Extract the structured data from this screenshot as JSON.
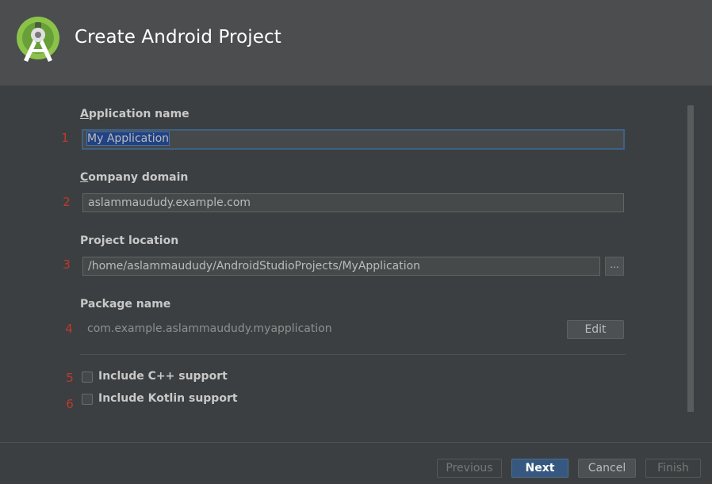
{
  "window": {
    "title": "Create Android Project"
  },
  "form": {
    "app_name": {
      "label_mnemonic": "A",
      "label_rest": "pplication name",
      "value": "My Application",
      "marker": "1"
    },
    "company_domain": {
      "label_mnemonic": "C",
      "label_rest": "ompany domain",
      "value": "aslammaududy.example.com",
      "marker": "2"
    },
    "project_location": {
      "label": "Project location",
      "value": "/home/aslammaududy/AndroidStudioProjects/MyApplication",
      "browse_label": "...",
      "marker": "3"
    },
    "package_name": {
      "label": "Package name",
      "value": "com.example.aslammaududy.myapplication",
      "edit_label": "Edit",
      "marker": "4"
    },
    "cpp_support": {
      "label": "Include C++ support",
      "checked": false,
      "marker": "5"
    },
    "kotlin_support": {
      "label": "Include Kotlin support",
      "checked": false,
      "marker": "6"
    }
  },
  "footer": {
    "previous": "Previous",
    "next": "Next",
    "cancel": "Cancel",
    "finish": "Finish"
  },
  "colors": {
    "annotation_marker": "#c0392b",
    "primary_button": "#365880",
    "logo_green": "#8bc34a"
  },
  "icons": {
    "logo": "android-studio-logo-icon"
  }
}
